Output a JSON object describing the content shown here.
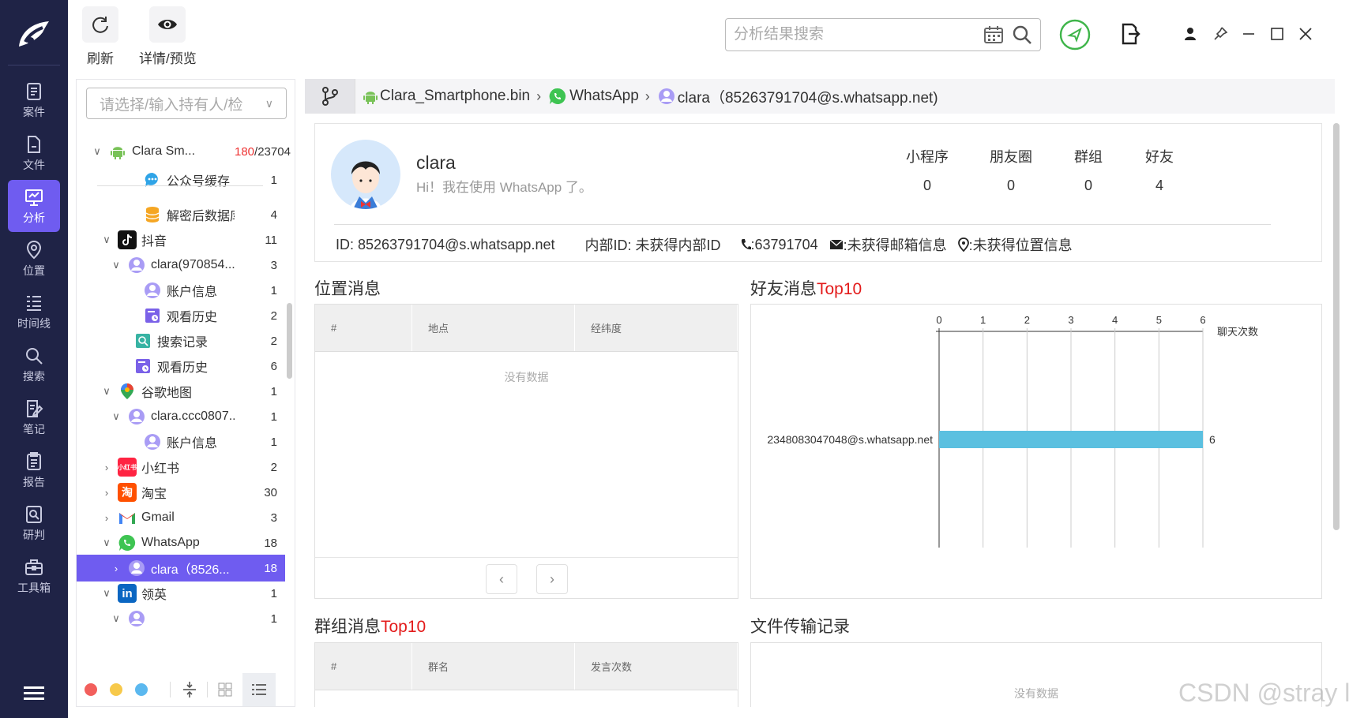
{
  "rail": {
    "items": [
      {
        "label": "案件",
        "icon": "case-icon"
      },
      {
        "label": "文件",
        "icon": "file-icon"
      },
      {
        "label": "分析",
        "icon": "analysis-icon"
      },
      {
        "label": "位置",
        "icon": "location-icon"
      },
      {
        "label": "时间线",
        "icon": "timeline-icon"
      },
      {
        "label": "搜索",
        "icon": "search-icon"
      },
      {
        "label": "笔记",
        "icon": "note-icon"
      },
      {
        "label": "报告",
        "icon": "report-icon"
      },
      {
        "label": "研判",
        "icon": "judge-icon"
      },
      {
        "label": "工具箱",
        "icon": "toolbox-icon"
      }
    ],
    "active_index": 2
  },
  "toolbar": {
    "refresh_label": "刷新",
    "detail_label": "详情/预览",
    "search_placeholder": "分析结果搜索"
  },
  "tree": {
    "select_placeholder": "请选择/输入持有人/检",
    "rows": [
      {
        "name": "Clara Sm...",
        "count_red": "180",
        "count": "/23704",
        "icon": "android-icon"
      },
      {
        "name": "公众号缓存",
        "count": "1",
        "icon": "chat-bubble-icon"
      },
      {
        "name": "解密后数据库",
        "count": "4",
        "icon": "database-icon"
      },
      {
        "name": "抖音",
        "count": "11",
        "icon": "tiktok-icon"
      },
      {
        "name": "clara(970854...",
        "count": "3",
        "icon": "user-icon"
      },
      {
        "name": "账户信息",
        "count": "1",
        "icon": "user-icon"
      },
      {
        "name": "观看历史",
        "count": "2",
        "icon": "history-icon"
      },
      {
        "name": "搜索记录",
        "count": "2",
        "icon": "search-record-icon"
      },
      {
        "name": "观看历史",
        "count": "6",
        "icon": "history-icon"
      },
      {
        "name": "谷歌地图",
        "count": "1",
        "icon": "google-maps-icon"
      },
      {
        "name": "clara.ccc0807...",
        "count": "1",
        "icon": "user-icon"
      },
      {
        "name": "账户信息",
        "count": "1",
        "icon": "user-icon"
      },
      {
        "name": "小红书",
        "count": "2",
        "icon": "xiaohongshu-icon",
        "badge": "小红书"
      },
      {
        "name": "淘宝",
        "count": "30",
        "icon": "taobao-icon",
        "badge": "淘"
      },
      {
        "name": "Gmail",
        "count": "3",
        "icon": "gmail-icon"
      },
      {
        "name": "WhatsApp",
        "count": "18",
        "icon": "whatsapp-icon"
      },
      {
        "name": "clara（8526...",
        "count": "18",
        "icon": "user-icon"
      },
      {
        "name": "领英",
        "count": "1",
        "icon": "linkedin-icon",
        "badge": "in"
      },
      {
        "name": "",
        "count": "1",
        "icon": "user-icon"
      }
    ]
  },
  "breadcrumb": {
    "device": "Clara_Smartphone.bin",
    "app": "WhatsApp",
    "account": "clara（85263791704@s.whatsapp.net)"
  },
  "profile": {
    "name": "clara",
    "status": "Hi！我在使用 WhatsApp 了。",
    "stats": [
      {
        "label": "小程序",
        "value": "0"
      },
      {
        "label": "朋友圈",
        "value": "0"
      },
      {
        "label": "群组",
        "value": "0"
      },
      {
        "label": "好友",
        "value": "4"
      }
    ],
    "id_text": "ID: 85263791704@s.whatsapp.net",
    "internal_id": "内部ID: 未获得内部ID",
    "phone": ":63791704",
    "email": ":未获得邮箱信息",
    "location": ":未获得位置信息"
  },
  "location_section": {
    "title": "位置消息",
    "columns": [
      "#",
      "地点",
      "经纬度"
    ],
    "empty_text": "没有数据"
  },
  "friends_section": {
    "title_prefix": "好友消息",
    "title_highlight": "Top10"
  },
  "group_section": {
    "title_prefix": "群组消息",
    "title_highlight": "Top10",
    "columns": [
      "#",
      "群名",
      "发言次数"
    ]
  },
  "file_section": {
    "title": "文件传输记录",
    "empty_text": "没有数据"
  },
  "chart_data": {
    "type": "bar",
    "orientation": "horizontal",
    "categories": [
      "2348083047048@s.whatsapp.net"
    ],
    "values": [
      6
    ],
    "xlabel": "聊天次数",
    "ticks": [
      "0",
      "1",
      "2",
      "3",
      "4",
      "5",
      "6"
    ],
    "xlim": [
      0,
      6
    ],
    "grid": true,
    "bar_color": "#5bc0e0",
    "data_labels": [
      "6"
    ]
  },
  "watermark": "CSDN @stray l"
}
